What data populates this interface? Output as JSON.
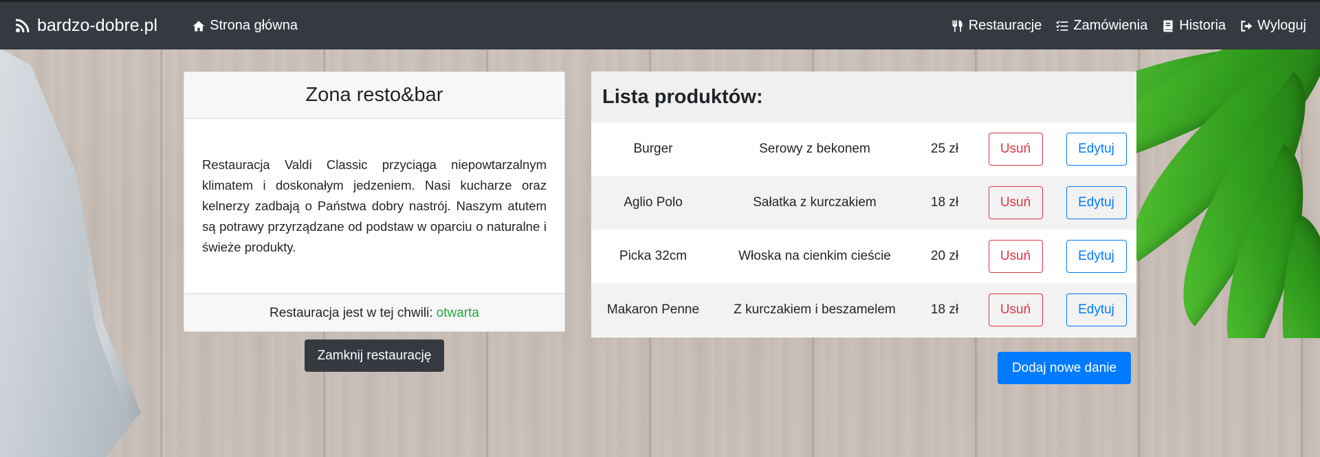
{
  "navbar": {
    "brand": "bardzo-dobre.pl",
    "home_label": "Strona główna",
    "items": [
      {
        "label": "Restauracje",
        "icon": "utensils-icon"
      },
      {
        "label": "Zamówienia",
        "icon": "tasks-icon"
      },
      {
        "label": "Historia",
        "icon": "book-icon"
      },
      {
        "label": "Wyloguj",
        "icon": "sign-out-icon"
      }
    ]
  },
  "restaurant": {
    "title": "Zona resto&bar",
    "description": "Restauracja Valdi Classic przyciąga niepowtarzalnym klimatem i doskonałym jedzeniem. Nasi kucharze oraz kelnerzy zadbają o Państwa dobry nastrój. Naszym atutem są potrawy przyrządzane od podstaw w oparciu o naturalne i świeże produkty.",
    "status_label": "Restauracja jest w tej chwili:",
    "status_value": "otwarta",
    "close_button": "Zamknij restaurację"
  },
  "products": {
    "title": "Lista produktów:",
    "delete_label": "Usuń",
    "edit_label": "Edytuj",
    "rows": [
      {
        "name": "Burger",
        "description": "Serowy z bekonem",
        "price": "25 zł"
      },
      {
        "name": "Aglio Polo",
        "description": "Sałatka z kurczakiem",
        "price": "18 zł"
      },
      {
        "name": "Picka 32cm",
        "description": "Włoska na cienkim cieście",
        "price": "20 zł"
      },
      {
        "name": "Makaron Penne",
        "description": "Z kurczakiem i beszamelem",
        "price": "18 zł"
      }
    ],
    "add_button": "Dodaj nowe danie"
  },
  "colors": {
    "navbar_bg": "#343a40",
    "status_open": "#28a745",
    "danger": "#dc3545",
    "primary": "#007bff"
  }
}
